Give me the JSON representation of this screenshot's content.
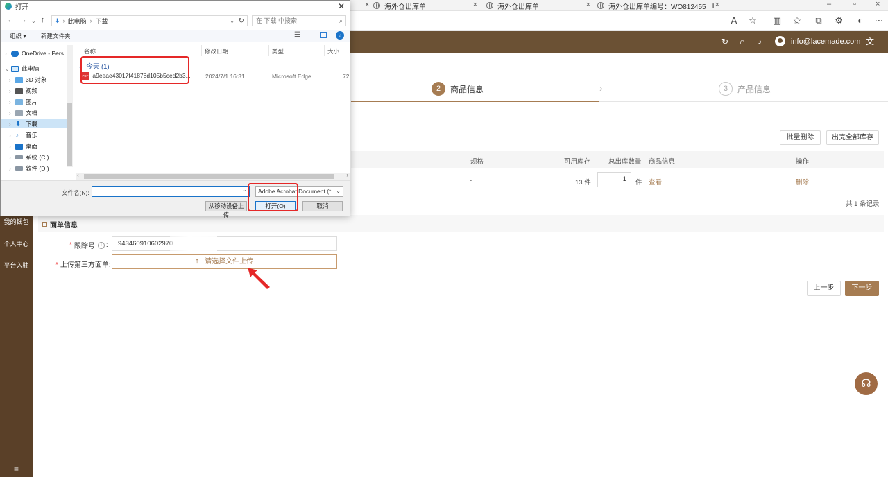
{
  "browser": {
    "tabs": [
      {
        "title": "海外仓出库单"
      },
      {
        "title": "海外仓出库单"
      },
      {
        "title": "海外仓出库单编号：WO812455"
      }
    ],
    "new_tab": "+"
  },
  "header": {
    "email": "info@lacemade.com"
  },
  "steps": [
    {
      "num": "2",
      "label": "商品信息"
    },
    {
      "num": "3",
      "label": "产品信息"
    }
  ],
  "actions": {
    "batch_delete": "批量删除",
    "out_all": "出完全部库存"
  },
  "table": {
    "headers": {
      "spec": "规格",
      "stock": "可用库存",
      "total": "总出库数量",
      "info": "商品信息",
      "ops": "操作"
    },
    "row": {
      "spec": "-",
      "stock": "13 件",
      "qty": "1",
      "unit": "件",
      "view": "查看",
      "delete": "删除"
    },
    "total": "共 1 条记录"
  },
  "sidebar": {
    "items": [
      "我的钱包",
      "个人中心",
      "平台入驻"
    ],
    "menu_icon": "≡"
  },
  "form": {
    "section_title": "面单信息",
    "tracking_label": "跟踪号",
    "tracking_value": "943460910602970",
    "upload_label": "上传第三方面单:",
    "upload_text": "请选择文件上传"
  },
  "nav_buttons": {
    "prev": "上一步",
    "next": "下一步"
  },
  "dialog": {
    "title": "打开",
    "path": [
      "此电脑",
      "下载"
    ],
    "search_placeholder": "在 下载 中搜索",
    "organize": "组织 ▾",
    "new_folder": "新建文件夹",
    "tree": [
      {
        "label": "OneDrive - Pers",
        "expand": "›"
      },
      {
        "label": "此电脑",
        "expand": "⌄"
      },
      {
        "label": "3D 对象",
        "expand": "›"
      },
      {
        "label": "视频",
        "expand": "›"
      },
      {
        "label": "图片",
        "expand": "›"
      },
      {
        "label": "文档",
        "expand": "›"
      },
      {
        "label": "下载",
        "expand": "›"
      },
      {
        "label": "音乐",
        "expand": "›"
      },
      {
        "label": "桌面",
        "expand": "›"
      },
      {
        "label": "系统 (C:)",
        "expand": "›"
      },
      {
        "label": "软件 (D:)",
        "expand": "›"
      }
    ],
    "columns": {
      "name": "名称",
      "date": "修改日期",
      "type": "类型",
      "size": "大小"
    },
    "group": "今天 (1)",
    "file": {
      "name": "a9eeae43017f41878d105b5ced2b3...",
      "date": "2024/7/1 16:31",
      "type": "Microsoft Edge ...",
      "size": "72"
    },
    "filename_label": "文件名(N):",
    "filename_value": "",
    "filetype": "Adobe Acrobat Document (*",
    "mobile_upload": "从移动设备上传",
    "open": "打开(O)",
    "cancel": "取消"
  },
  "colors": {
    "brand": "#6b5134",
    "accent": "#a67c52",
    "highlight": "#e52828"
  }
}
